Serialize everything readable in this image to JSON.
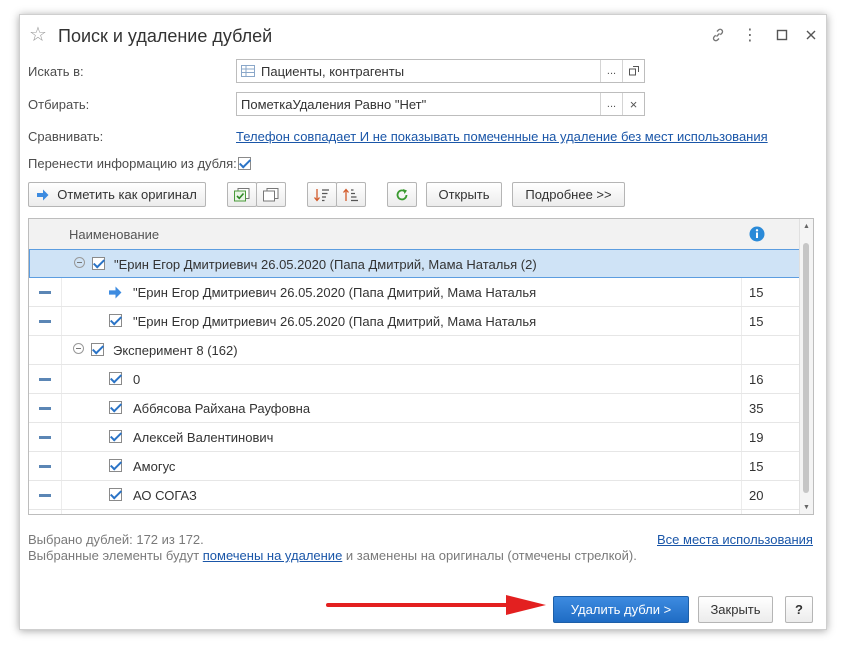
{
  "window": {
    "title": "Поиск и удаление дублей",
    "header_buttons": [
      "link-icon",
      "more-icon",
      "maximize-icon",
      "close-icon"
    ]
  },
  "form": {
    "search_in_label": "Искать в:",
    "search_in_value": "Пациенты, контрагенты",
    "filter_label": "Отбирать:",
    "filter_value": "ПометкаУдаления Равно \"Нет\"",
    "compare_label": "Сравнивать:",
    "compare_link": "Телефон совпадает И не показывать помеченные на удаление без мест использования",
    "transfer_label": "Перенести информацию из дубля:",
    "transfer_checked": true
  },
  "toolbar": {
    "mark_original": "Отметить как оригинал",
    "open": "Открыть",
    "more": "Подробнее >>"
  },
  "table": {
    "col_name": "Наименование",
    "col_info_icon": "info-icon",
    "groups": [
      {
        "label": "\"Ерин Егор Дмитриевич  26.05.2020 (Папа Дмитрий, Мама Наталья (2)",
        "selected": true,
        "items": [
          {
            "label": "\"Ерин Егор Дмитриевич  26.05.2020 (Папа Дмитрий, Мама Наталья",
            "count": "15",
            "original": true
          },
          {
            "label": "\"Ерин Егор Дмитриевич  26.05.2020 (Папа Дмитрий, Мама Наталья",
            "count": "15",
            "original": false
          }
        ]
      },
      {
        "label": "Эксперимент 8  (162)",
        "selected": false,
        "items": [
          {
            "label": "0",
            "count": "16",
            "original": false
          },
          {
            "label": "Аббясова Райхана Рауфовна",
            "count": "35",
            "original": false
          },
          {
            "label": "Алексей Валентинович",
            "count": "19",
            "original": false
          },
          {
            "label": "Амогус",
            "count": "15",
            "original": false
          },
          {
            "label": "АО СОГАЗ",
            "count": "20",
            "original": false
          }
        ]
      }
    ]
  },
  "footer": {
    "selected_text": "Выбрано дублей: 172 из 172.",
    "all_places_link": "Все места использования",
    "note_before": "Выбранные элементы будут ",
    "note_link": "помечены на удаление",
    "note_after": " и заменены на оригиналы (отмечены стрелкой).",
    "delete_button": "Удалить дубли >",
    "close_button": "Закрыть",
    "help_button": "?"
  },
  "colors": {
    "accent": "#2a73c6",
    "primary_button": "#1f6cc4",
    "annotation_arrow": "#e32020"
  }
}
